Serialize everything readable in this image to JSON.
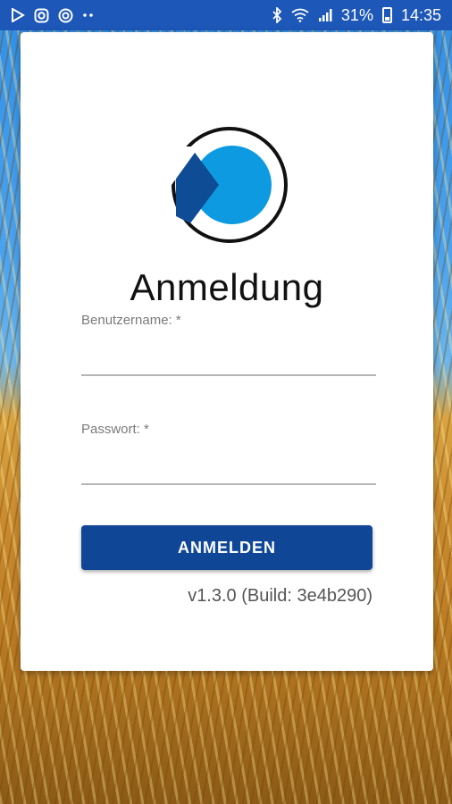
{
  "status_bar": {
    "left_icons": [
      "play-store-icon",
      "instagram-icon",
      "at-sign-icon",
      "more-dots-icon"
    ],
    "right_icons": [
      "bluetooth-icon",
      "wifi-icon",
      "signal-icon"
    ],
    "battery_percent": "31%",
    "time": "14:35",
    "background": "#1d57b8"
  },
  "login": {
    "title": "Anmeldung",
    "username_label": "Benutzername: *",
    "username_value": "",
    "password_label": "Passwort: *",
    "password_value": "",
    "submit_label": "ANMELDEN",
    "version": "v1.3.0 (Build: 3e4b290)"
  },
  "colors": {
    "button": "#0f4796",
    "logo_dark": "#0e4c96",
    "logo_light": "#0d9ae0"
  }
}
